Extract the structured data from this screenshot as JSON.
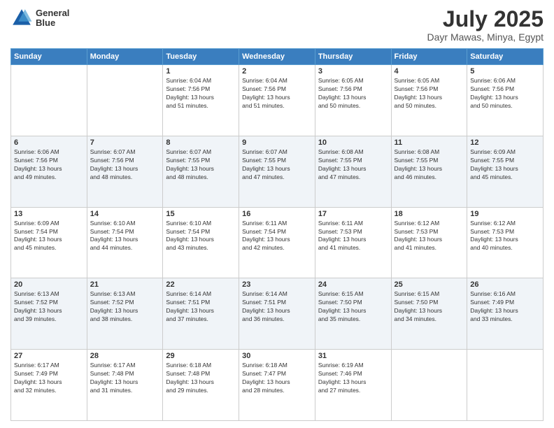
{
  "header": {
    "logo_line1": "General",
    "logo_line2": "Blue",
    "month": "July 2025",
    "location": "Dayr Mawas, Minya, Egypt"
  },
  "days_of_week": [
    "Sunday",
    "Monday",
    "Tuesday",
    "Wednesday",
    "Thursday",
    "Friday",
    "Saturday"
  ],
  "weeks": [
    [
      {
        "day": "",
        "info": ""
      },
      {
        "day": "",
        "info": ""
      },
      {
        "day": "1",
        "info": "Sunrise: 6:04 AM\nSunset: 7:56 PM\nDaylight: 13 hours\nand 51 minutes."
      },
      {
        "day": "2",
        "info": "Sunrise: 6:04 AM\nSunset: 7:56 PM\nDaylight: 13 hours\nand 51 minutes."
      },
      {
        "day": "3",
        "info": "Sunrise: 6:05 AM\nSunset: 7:56 PM\nDaylight: 13 hours\nand 50 minutes."
      },
      {
        "day": "4",
        "info": "Sunrise: 6:05 AM\nSunset: 7:56 PM\nDaylight: 13 hours\nand 50 minutes."
      },
      {
        "day": "5",
        "info": "Sunrise: 6:06 AM\nSunset: 7:56 PM\nDaylight: 13 hours\nand 50 minutes."
      }
    ],
    [
      {
        "day": "6",
        "info": "Sunrise: 6:06 AM\nSunset: 7:56 PM\nDaylight: 13 hours\nand 49 minutes."
      },
      {
        "day": "7",
        "info": "Sunrise: 6:07 AM\nSunset: 7:56 PM\nDaylight: 13 hours\nand 48 minutes."
      },
      {
        "day": "8",
        "info": "Sunrise: 6:07 AM\nSunset: 7:55 PM\nDaylight: 13 hours\nand 48 minutes."
      },
      {
        "day": "9",
        "info": "Sunrise: 6:07 AM\nSunset: 7:55 PM\nDaylight: 13 hours\nand 47 minutes."
      },
      {
        "day": "10",
        "info": "Sunrise: 6:08 AM\nSunset: 7:55 PM\nDaylight: 13 hours\nand 47 minutes."
      },
      {
        "day": "11",
        "info": "Sunrise: 6:08 AM\nSunset: 7:55 PM\nDaylight: 13 hours\nand 46 minutes."
      },
      {
        "day": "12",
        "info": "Sunrise: 6:09 AM\nSunset: 7:55 PM\nDaylight: 13 hours\nand 45 minutes."
      }
    ],
    [
      {
        "day": "13",
        "info": "Sunrise: 6:09 AM\nSunset: 7:54 PM\nDaylight: 13 hours\nand 45 minutes."
      },
      {
        "day": "14",
        "info": "Sunrise: 6:10 AM\nSunset: 7:54 PM\nDaylight: 13 hours\nand 44 minutes."
      },
      {
        "day": "15",
        "info": "Sunrise: 6:10 AM\nSunset: 7:54 PM\nDaylight: 13 hours\nand 43 minutes."
      },
      {
        "day": "16",
        "info": "Sunrise: 6:11 AM\nSunset: 7:54 PM\nDaylight: 13 hours\nand 42 minutes."
      },
      {
        "day": "17",
        "info": "Sunrise: 6:11 AM\nSunset: 7:53 PM\nDaylight: 13 hours\nand 41 minutes."
      },
      {
        "day": "18",
        "info": "Sunrise: 6:12 AM\nSunset: 7:53 PM\nDaylight: 13 hours\nand 41 minutes."
      },
      {
        "day": "19",
        "info": "Sunrise: 6:12 AM\nSunset: 7:53 PM\nDaylight: 13 hours\nand 40 minutes."
      }
    ],
    [
      {
        "day": "20",
        "info": "Sunrise: 6:13 AM\nSunset: 7:52 PM\nDaylight: 13 hours\nand 39 minutes."
      },
      {
        "day": "21",
        "info": "Sunrise: 6:13 AM\nSunset: 7:52 PM\nDaylight: 13 hours\nand 38 minutes."
      },
      {
        "day": "22",
        "info": "Sunrise: 6:14 AM\nSunset: 7:51 PM\nDaylight: 13 hours\nand 37 minutes."
      },
      {
        "day": "23",
        "info": "Sunrise: 6:14 AM\nSunset: 7:51 PM\nDaylight: 13 hours\nand 36 minutes."
      },
      {
        "day": "24",
        "info": "Sunrise: 6:15 AM\nSunset: 7:50 PM\nDaylight: 13 hours\nand 35 minutes."
      },
      {
        "day": "25",
        "info": "Sunrise: 6:15 AM\nSunset: 7:50 PM\nDaylight: 13 hours\nand 34 minutes."
      },
      {
        "day": "26",
        "info": "Sunrise: 6:16 AM\nSunset: 7:49 PM\nDaylight: 13 hours\nand 33 minutes."
      }
    ],
    [
      {
        "day": "27",
        "info": "Sunrise: 6:17 AM\nSunset: 7:49 PM\nDaylight: 13 hours\nand 32 minutes."
      },
      {
        "day": "28",
        "info": "Sunrise: 6:17 AM\nSunset: 7:48 PM\nDaylight: 13 hours\nand 31 minutes."
      },
      {
        "day": "29",
        "info": "Sunrise: 6:18 AM\nSunset: 7:48 PM\nDaylight: 13 hours\nand 29 minutes."
      },
      {
        "day": "30",
        "info": "Sunrise: 6:18 AM\nSunset: 7:47 PM\nDaylight: 13 hours\nand 28 minutes."
      },
      {
        "day": "31",
        "info": "Sunrise: 6:19 AM\nSunset: 7:46 PM\nDaylight: 13 hours\nand 27 minutes."
      },
      {
        "day": "",
        "info": ""
      },
      {
        "day": "",
        "info": ""
      }
    ]
  ]
}
